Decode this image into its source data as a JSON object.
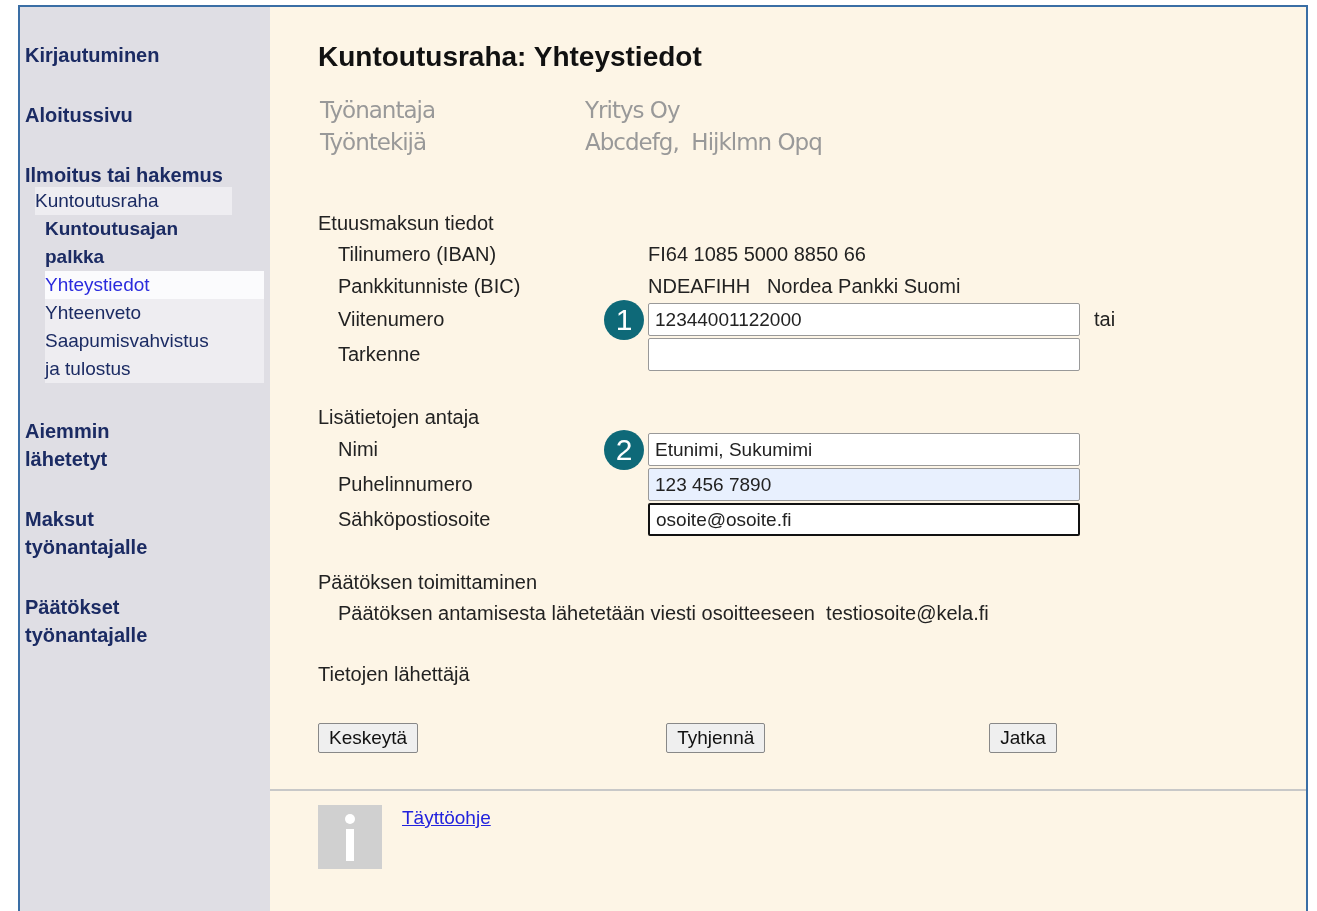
{
  "sidebar": {
    "items": [
      {
        "label": "Kirjautuminen"
      },
      {
        "label": "Aloitussivu"
      },
      {
        "label": "Ilmoitus tai hakemus",
        "group": {
          "label": "Kuntoutusraha",
          "children": [
            {
              "label": "Kuntoutusajan\npalkka",
              "kind": "bold",
              "selected": false
            },
            {
              "label": "Yhteystiedot",
              "kind": "plain",
              "selected": true
            },
            {
              "label": "Yhteenveto",
              "kind": "plain",
              "selected": false
            },
            {
              "label": "Saapumisvahvistus\nja tulostus",
              "kind": "plain",
              "selected": false
            }
          ]
        }
      },
      {
        "label": "Aiemmin\nlähetetyt"
      },
      {
        "label": "Maksut\ntyönantajalle"
      },
      {
        "label": "Päätökset\ntyönantajalle"
      }
    ]
  },
  "title": "Kuntoutusraha: Yhteystiedot",
  "parties": [
    {
      "label": "Työnantaja",
      "value": "Yritys Oy"
    },
    {
      "label": "Työntekijä",
      "value": "Abcdefg,  Hijklmn Opq"
    }
  ],
  "sections": [
    {
      "title": "Etuusmaksun tiedot",
      "marker": "1",
      "rows": [
        {
          "label": "Tilinumero (IBAN)",
          "kind": "text",
          "value": "FI64 1085 5000 8850 66"
        },
        {
          "label": "Pankkitunniste (BIC)",
          "kind": "text",
          "value": "NDEAFIHH   Nordea Pankki Suomi"
        },
        {
          "label": "Viitenumero",
          "kind": "field",
          "value": "12344001122000",
          "after": "tai",
          "focused": false,
          "autofilled": false
        },
        {
          "label": "Tarkenne",
          "kind": "field",
          "focused": false,
          "autofilled": false
        }
      ]
    },
    {
      "title": "Lisätietojen antaja",
      "marker": "2",
      "rows": [
        {
          "label": "Nimi",
          "kind": "field",
          "value": "Etunimi, Sukumimi",
          "focused": false,
          "autofilled": false
        },
        {
          "label": "Puhelinnumero",
          "kind": "field",
          "value": "123 456 7890",
          "focused": false,
          "autofilled": true
        },
        {
          "label": "Sähköpostiosoite",
          "kind": "field",
          "value": "osoite@osoite.fi",
          "focused": true,
          "autofilled": false
        }
      ]
    },
    {
      "title": "Päätöksen toimittaminen",
      "rows": [
        {
          "kind": "note",
          "value": "Päätöksen antamisesta lähetetään viesti osoitteeseen  testiosoite@kela.fi"
        }
      ]
    },
    {
      "title": "Tietojen lähettäjä"
    }
  ],
  "buttons": [
    "Keskeytä",
    "Tyhjennä",
    "Jatka"
  ],
  "help_link": "Täyttöohje"
}
